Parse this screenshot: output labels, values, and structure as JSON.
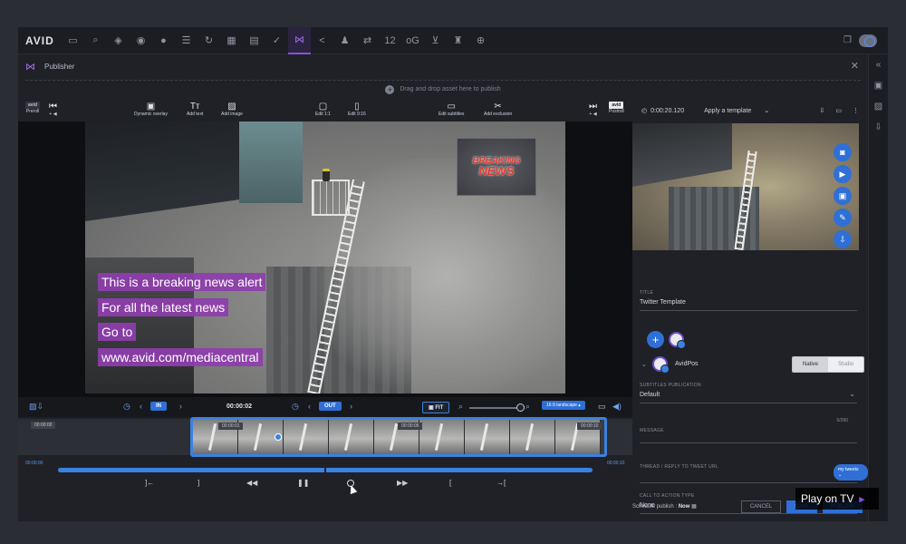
{
  "nav": {
    "logo": "AVID",
    "icons": [
      "folder-icon",
      "search-icon",
      "eye-icon",
      "user-circle-icon",
      "chat-icon",
      "list-icon",
      "refresh-icon",
      "grid-icon",
      "clipboard-icon",
      "check-circle-icon",
      "share-active-icon",
      "share-icon",
      "person-icon",
      "swap-icon",
      "numbers-icon",
      "og-icon",
      "cart-icon",
      "trophy-icon",
      "zoom-icon"
    ],
    "numbers_label": "12",
    "og_label": "oG"
  },
  "publisher": {
    "title": "Publisher",
    "dropzone": "Drag and drop asset here to publish"
  },
  "toolbar": {
    "preroll": "Preroll",
    "dynamic_overlay": "Dynamic overlay",
    "add_text": "Add text",
    "add_image": "Add image",
    "edit_11": "Edit 1:1",
    "edit_916": "Edit 9:16",
    "edit_subtitles": "Edit subtitles",
    "add_exclusion": "Add exclusion",
    "postroll": "Postroll"
  },
  "video": {
    "breaking_line1": "BREAKING",
    "breaking_line2": "NEWS",
    "subtitles": [
      "This is a breaking news alert",
      "For all the latest news",
      "Go to",
      "www.avid.com/mediacentral"
    ]
  },
  "transport": {
    "in_label": "IN",
    "out_label": "OUT",
    "timecode": "00:00:02",
    "fit_label": "FIT",
    "ratio_label": "16:9 landscape"
  },
  "timeline": {
    "labels": [
      "00:00:00",
      "00:00:01",
      "00:00:05",
      "00:00:10"
    ],
    "start_time": "00:00:00",
    "end_time": "00:00:10"
  },
  "panel": {
    "duration": "0:00:20.120",
    "template_label": "Apply a template",
    "fields": {
      "title_label": "TITLE",
      "title_value": "Twitter Template",
      "account_name": "AvidPos",
      "native_label": "Native",
      "studio_label": "Studio",
      "subtitles_label": "SUBTITLES PUBLICATION",
      "subtitles_value": "Default",
      "counter": "0/280",
      "message_label": "MESSAGE",
      "thread_label": "THREAD / REPLY TO TWEET URL",
      "my_tweets": "my tweets",
      "cta_label": "CALL TO ACTION TYPE",
      "cta_value": "None"
    }
  },
  "footer": {
    "schedule_label": "Schedule publish :",
    "schedule_value": "Now",
    "cancel": "CANCEL",
    "save": "SAVE",
    "publish": "PUBLISH"
  },
  "overlay": {
    "play_on_tv": "Play on TV"
  },
  "colors": {
    "accent_blue": "#2f6fd6",
    "accent_purple": "#8b4fe0",
    "subtitle_bg": "#8e3eac",
    "breaking_red": "#e23a2f"
  }
}
